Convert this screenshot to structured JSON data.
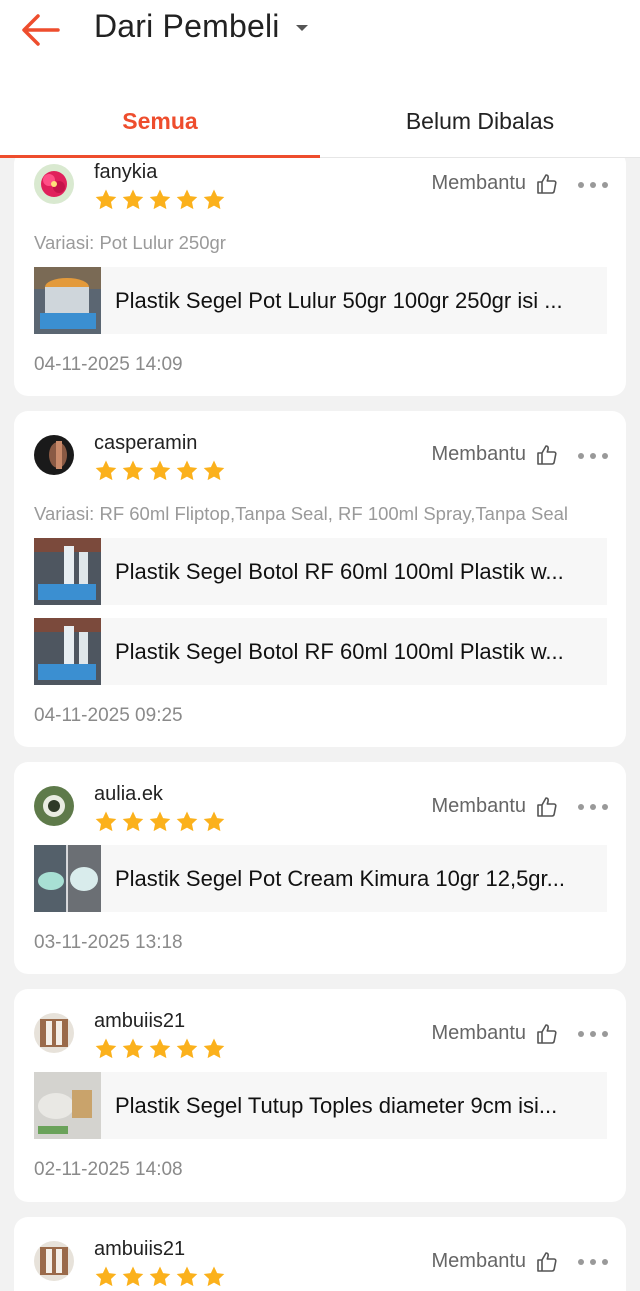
{
  "header": {
    "title": "Dari Pembeli",
    "tabs": [
      {
        "label": "Semua",
        "active": true
      },
      {
        "label": "Belum Dibalas",
        "active": false
      }
    ],
    "accent_color": "#ee4d2d"
  },
  "reviews": [
    {
      "username": "fanykia",
      "rating": 5,
      "helpful_label": "Membantu",
      "variation": "Variasi: Pot Lulur 250gr",
      "products": [
        "Plastik Segel Pot Lulur 50gr 100gr 250gr isi ..."
      ],
      "date": "04-11-2025 14:09"
    },
    {
      "username": "casperamin",
      "rating": 5,
      "helpful_label": "Membantu",
      "variation": "Variasi: RF 60ml Fliptop,Tanpa Seal, RF 100ml Spray,Tanpa Seal",
      "products": [
        "Plastik Segel Botol RF 60ml 100ml Plastik w...",
        "Plastik Segel Botol RF 60ml 100ml Plastik w..."
      ],
      "date": "04-11-2025 09:25"
    },
    {
      "username": "aulia.ek",
      "rating": 5,
      "helpful_label": "Membantu",
      "products": [
        "Plastik Segel Pot Cream Kimura 10gr 12,5gr..."
      ],
      "date": "03-11-2025 13:18"
    },
    {
      "username": "ambuiis21",
      "rating": 5,
      "helpful_label": "Membantu",
      "products": [
        "Plastik Segel Tutup Toples diameter 9cm isi..."
      ],
      "date": "02-11-2025 14:08"
    },
    {
      "username": "ambuiis21",
      "rating": 5,
      "helpful_label": "Membantu"
    }
  ],
  "colors": {
    "star": "#fbb11c",
    "background": "#f2f2f2"
  }
}
